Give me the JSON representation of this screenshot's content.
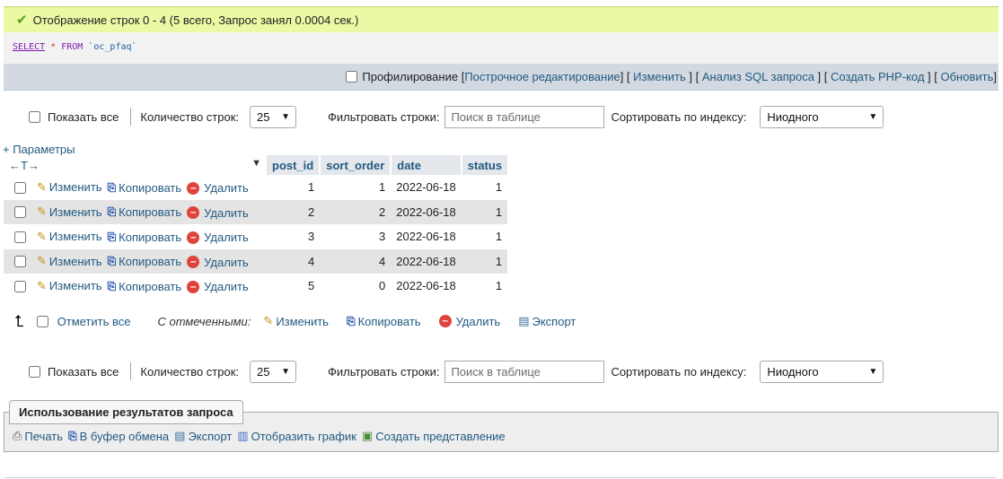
{
  "success_message": "Отображение строк 0 - 4 (5 всего, Запрос занял 0.0004 сек.)",
  "sql": {
    "select": "SELECT",
    "star": "*",
    "from": "FROM",
    "table": "`oc_pfaq`"
  },
  "toolbar": {
    "profiling": "Профилирование",
    "inline_edit": "Построчное редактирование",
    "edit": "Изменить",
    "analyze": "Анализ SQL запроса",
    "create_php": "Создать PHP-код",
    "refresh": "Обновить"
  },
  "nav": {
    "show_all": "Показать все",
    "rows_label": "Количество строк:",
    "rows_value": "25",
    "filter_label": "Фильтровать строки:",
    "filter_placeholder": "Поиск в таблице",
    "sort_label": "Сортировать по индексу:",
    "sort_value": "Ниодного"
  },
  "params_link": "+ Параметры",
  "column_arrows": "←T→",
  "columns": [
    "post_id",
    "sort_order",
    "date",
    "status"
  ],
  "actions": {
    "edit": "Изменить",
    "copy": "Копировать",
    "delete": "Удалить"
  },
  "rows": [
    {
      "post_id": "1",
      "sort_order": "1",
      "date": "2022-06-18",
      "status": "1"
    },
    {
      "post_id": "2",
      "sort_order": "2",
      "date": "2022-06-18",
      "status": "1"
    },
    {
      "post_id": "3",
      "sort_order": "3",
      "date": "2022-06-18",
      "status": "1"
    },
    {
      "post_id": "4",
      "sort_order": "4",
      "date": "2022-06-18",
      "status": "1"
    },
    {
      "post_id": "5",
      "sort_order": "0",
      "date": "2022-06-18",
      "status": "1"
    }
  ],
  "bulk": {
    "check_all": "Отметить все",
    "with_selected": "С отмеченными:",
    "edit": "Изменить",
    "copy": "Копировать",
    "delete": "Удалить",
    "export": "Экспорт"
  },
  "query_results": {
    "legend": "Использование результатов запроса",
    "print": "Печать",
    "clipboard": "В буфер обмена",
    "export": "Экспорт",
    "chart": "Отобразить график",
    "view": "Создать представление"
  }
}
